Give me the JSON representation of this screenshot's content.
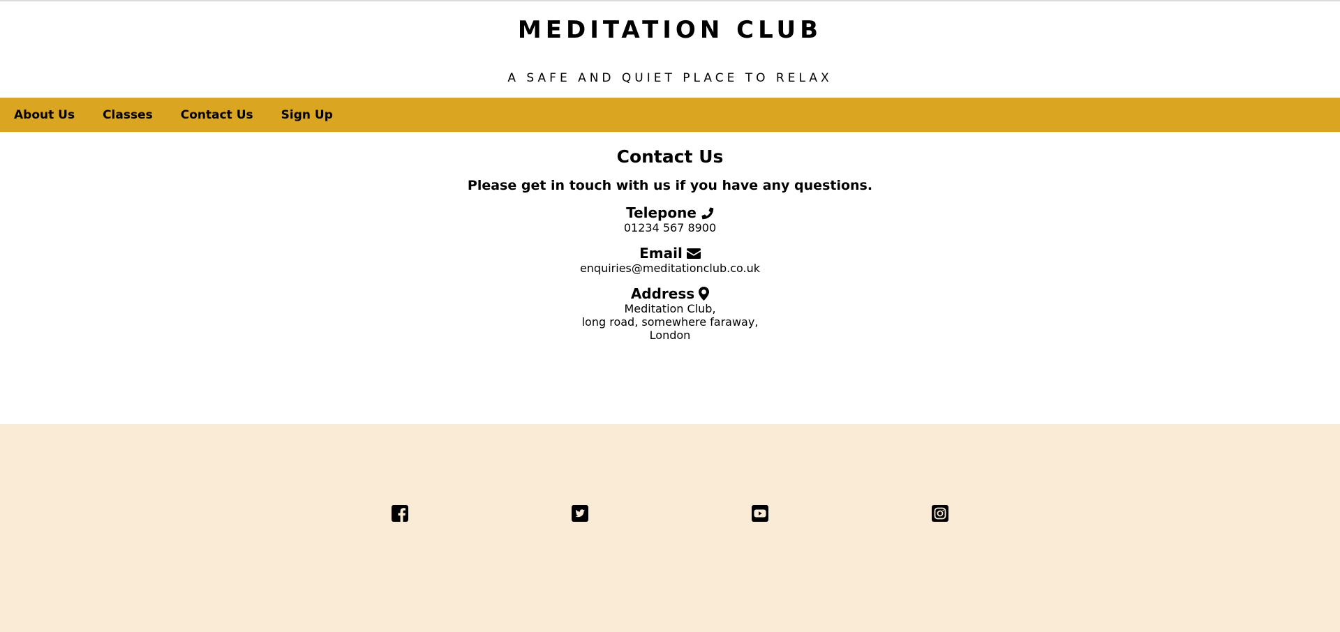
{
  "header": {
    "title": "MEDITATION CLUB",
    "tagline": "A SAFE AND QUIET PLACE TO RELAX"
  },
  "nav": {
    "items": [
      {
        "label": "About Us"
      },
      {
        "label": "Classes"
      },
      {
        "label": "Contact Us"
      },
      {
        "label": "Sign Up"
      }
    ],
    "background": "#daa520"
  },
  "contact": {
    "heading": "Contact Us",
    "intro": "Please get in touch with us if you have any questions.",
    "telephone": {
      "label": "Telepone",
      "icon": "phone-icon",
      "value": "01234 567 8900"
    },
    "email": {
      "label": "Email",
      "icon": "envelope-icon",
      "value": "enquiries@meditationclub.co.uk"
    },
    "address": {
      "label": "Address",
      "icon": "map-marker-icon",
      "lines": [
        "Meditation Club,",
        "long road, somewhere faraway,",
        "London"
      ]
    }
  },
  "footer": {
    "background": "#faebd7",
    "social": [
      "facebook-icon",
      "twitter-icon",
      "youtube-icon",
      "instagram-icon"
    ]
  }
}
